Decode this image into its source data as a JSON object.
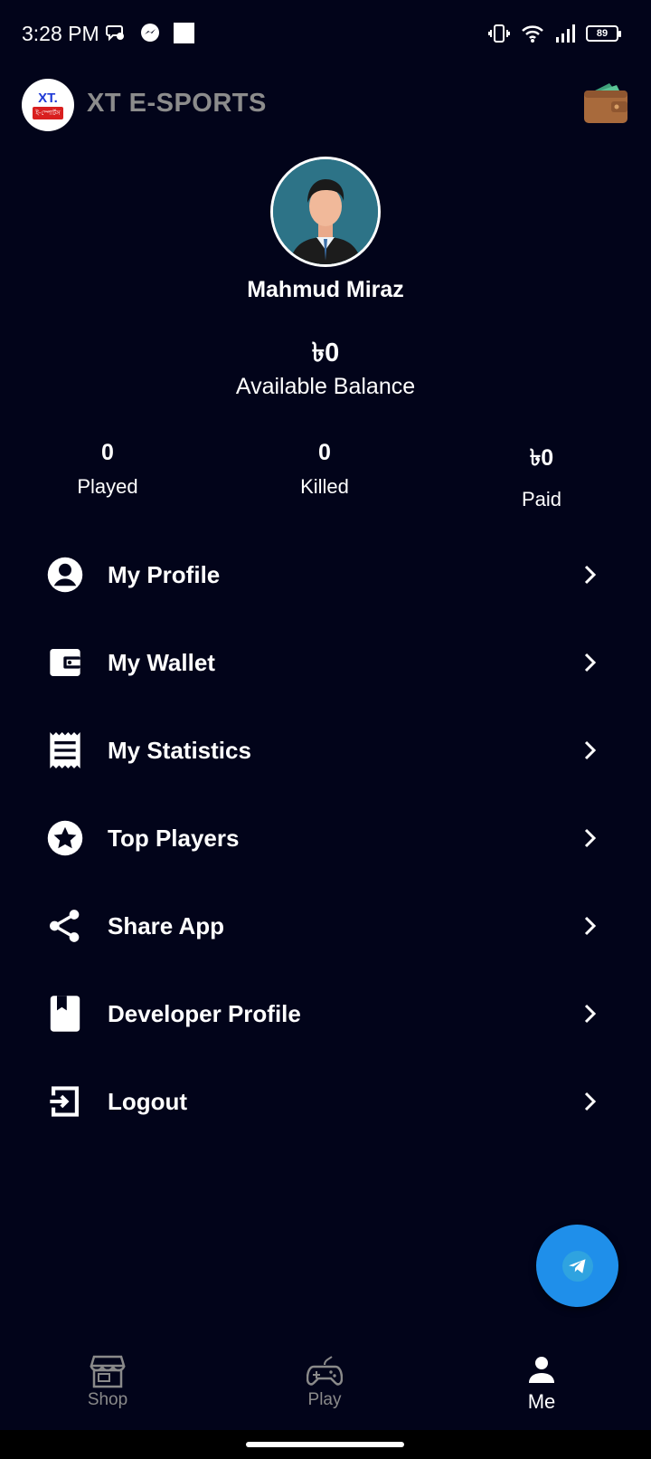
{
  "status_bar": {
    "time": "3:28 PM",
    "battery": "89"
  },
  "app_bar": {
    "logo_text": "XT.",
    "logo_sub": "ই-স্পোর্টস",
    "title": "XT E-SPORTS"
  },
  "profile": {
    "name": "Mahmud Miraz",
    "balance": "৳0",
    "balance_label": "Available Balance"
  },
  "stats": [
    {
      "value": "0",
      "label": "Played"
    },
    {
      "value": "0",
      "label": "Killed"
    },
    {
      "value": "৳0",
      "label": "Paid"
    }
  ],
  "menu": [
    {
      "label": "My Profile",
      "icon": "account-circle-icon"
    },
    {
      "label": "My Wallet",
      "icon": "wallet-icon"
    },
    {
      "label": "My Statistics",
      "icon": "receipt-icon"
    },
    {
      "label": "Top Players",
      "icon": "star-circle-icon"
    },
    {
      "label": "Share App",
      "icon": "share-icon"
    },
    {
      "label": "Developer Profile",
      "icon": "bookmark-book-icon"
    },
    {
      "label": "Logout",
      "icon": "logout-icon"
    }
  ],
  "bottom_nav": [
    {
      "label": "Shop",
      "icon": "store-icon"
    },
    {
      "label": "Play",
      "icon": "gamepad-icon"
    },
    {
      "label": "Me",
      "icon": "person-icon",
      "active": true
    }
  ],
  "colors": {
    "background": "#02041a",
    "fab": "#1f8fea",
    "inactive_nav": "#8a8a8a"
  }
}
